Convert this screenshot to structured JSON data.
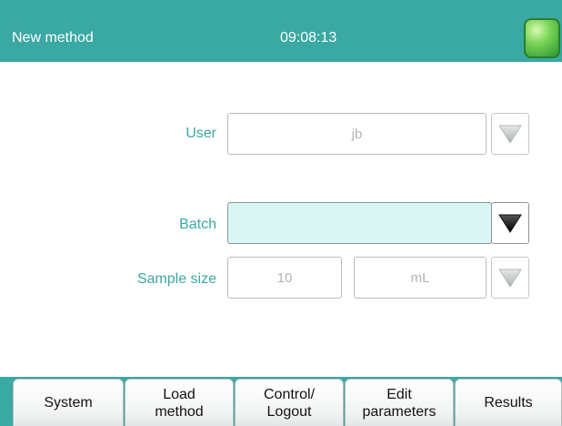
{
  "header": {
    "title": "New method",
    "time": "09:08:13"
  },
  "form": {
    "user": {
      "label": "User",
      "value": "jb"
    },
    "batch": {
      "label": "Batch",
      "value": ""
    },
    "sample_size": {
      "label": "Sample size",
      "value": "10",
      "unit": "mL"
    }
  },
  "tabs": [
    {
      "label": "System"
    },
    {
      "label": "Load\nmethod"
    },
    {
      "label": "Control/\nLogout"
    },
    {
      "label": "Edit\nparameters"
    },
    {
      "label": "Results"
    }
  ],
  "colors": {
    "accent": "#3aa8a3",
    "label": "#3aa8a3",
    "active_field": "#d9f6f5",
    "status_ok": "#5cc44a"
  },
  "icons": {
    "status": "status-led-green",
    "dropdown": "triangle-down"
  }
}
